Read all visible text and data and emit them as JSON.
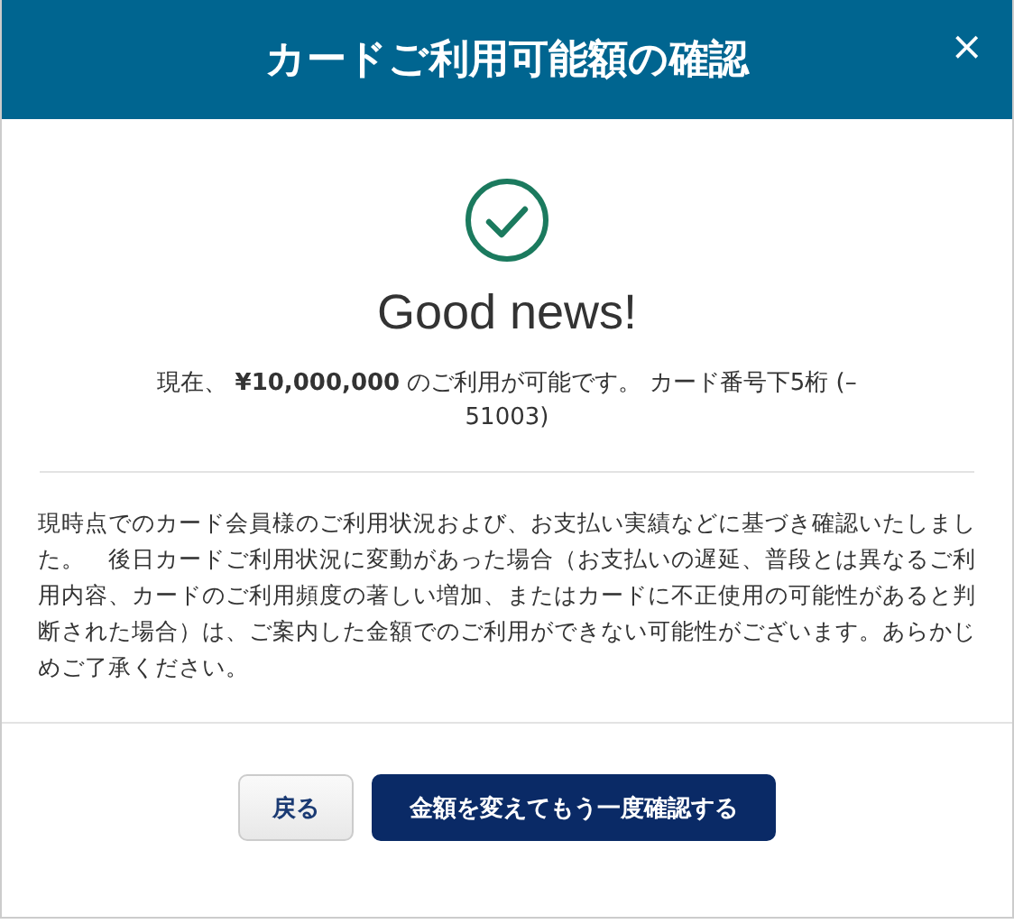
{
  "dialog": {
    "title": "カードご利用可能額の確認",
    "close": "×"
  },
  "result": {
    "success": true,
    "heading": "Good news!",
    "message": "現在、 **¥10,000,000** のご利用が可能です。 カード番号下5桁 (–51003)"
  },
  "notice": "現時点でのカード会員様のご利用状況および、お支払い実績などに基づき確認いたしました。　後日カードご利用状況に変動があった場合（お支払いの遅延、普段とは異なるご利用内容、カードのご利用頻度の著しい増加、またはカードに不正使用の可能性があると判断された場合）は、ご案内した金額でのご利用ができない可能性がございます。あらかじめご了承ください。",
  "buttons": [
    {
      "label": "戻る",
      "kind": "secondary"
    },
    {
      "label": "金額を変えてもう一度確認する",
      "kind": "primary"
    }
  ]
}
